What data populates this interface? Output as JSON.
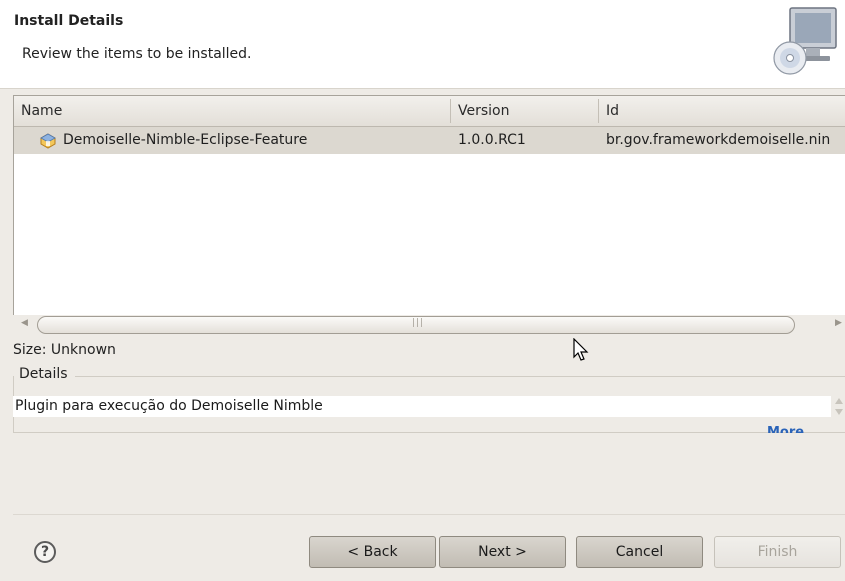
{
  "banner": {
    "title": "Install Details",
    "subtitle": "Review the items to be installed.",
    "icon": "computer-cd-icon"
  },
  "table": {
    "columns": [
      "Name",
      "Version",
      "Id"
    ],
    "rows": [
      {
        "name": "Demoiselle-Nimble-Eclipse-Feature",
        "version": "1.0.0.RC1",
        "id": "br.gov.frameworkdemoiselle.nin",
        "icon": "feature-icon",
        "selected": true
      }
    ]
  },
  "size_label": "Size: Unknown",
  "details": {
    "legend": "Details",
    "text": "Plugin para execução do Demoiselle Nimble",
    "more_link": "More..."
  },
  "buttons": {
    "back": "< Back",
    "next": "Next >",
    "cancel": "Cancel",
    "finish": "Finish",
    "help": "?"
  }
}
